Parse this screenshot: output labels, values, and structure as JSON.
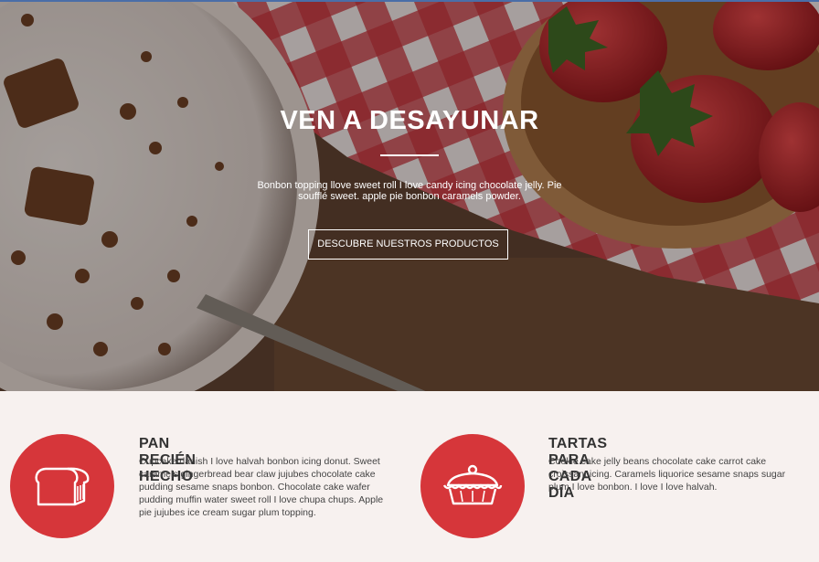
{
  "hero": {
    "title": "VEN A DESAYUNAR",
    "text": "Bonbon topping llove sweet roll I love candy icing chocolate jelly. Pie soufflé sweet. apple pie bonbon caramels powder.",
    "button_label": "DESCUBRE NUESTROS PRODUCTOS"
  },
  "features": [
    {
      "title": "PAN RECIÉN HECHO",
      "text": "Cupcake danish I love halvah bonbon icing donut. Sweet caramels gingerbread bear claw jujubes chocolate cake pudding sesame snaps bonbon. Chocolate cake wafer pudding muffin water sweet roll I love chupa chups. Apple pie jujubes ice cream sugar plum topping.",
      "icon": "bread-icon"
    },
    {
      "title": "TARTAS PARA CADA DÍA",
      "text": "Cookie cake jelly beans chocolate cake carrot cake croissant icing. Caramels liquorice sesame snaps sugar plum I love bonbon. I love I love halvah.",
      "icon": "pie-icon"
    }
  ],
  "colors": {
    "accent": "#d6363a",
    "background": "#f7f1ef"
  }
}
